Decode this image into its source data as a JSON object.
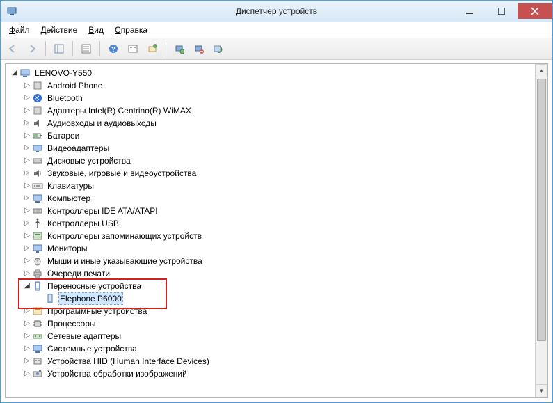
{
  "window": {
    "title": "Диспетчер устройств"
  },
  "menu": {
    "file": {
      "label": "Файл",
      "underline_index": 0
    },
    "action": {
      "label": "Действие",
      "underline_index": 0
    },
    "view": {
      "label": "Вид",
      "underline_index": 0
    },
    "help": {
      "label": "Справка",
      "underline_index": 0
    }
  },
  "toolbar": {
    "back": "back",
    "forward": "forward",
    "show_hide_tree": "show-hide-console-tree",
    "properties": "properties",
    "help": "help",
    "show_hidden": "show-hidden",
    "update_config": "update-driver-config",
    "scan": "scan-hardware",
    "remove": "remove-device",
    "update_drv": "update-driver"
  },
  "tree": {
    "root": {
      "label": "LENOVO-Y550",
      "icon": "computer"
    },
    "categories": [
      {
        "label": "Android Phone",
        "icon": "device-generic"
      },
      {
        "label": "Bluetooth",
        "icon": "bluetooth"
      },
      {
        "label": "Адаптеры Intel(R) Centrino(R) WiMAX",
        "icon": "device-generic"
      },
      {
        "label": "Аудиовходы и аудиовыходы",
        "icon": "audio"
      },
      {
        "label": "Батареи",
        "icon": "battery"
      },
      {
        "label": "Видеоадаптеры",
        "icon": "display-adapter"
      },
      {
        "label": "Дисковые устройства",
        "icon": "disk"
      },
      {
        "label": "Звуковые, игровые и видеоустройства",
        "icon": "sound"
      },
      {
        "label": "Клавиатуры",
        "icon": "keyboard"
      },
      {
        "label": "Компьютер",
        "icon": "computer"
      },
      {
        "label": "Контроллеры IDE ATA/ATAPI",
        "icon": "ide"
      },
      {
        "label": "Контроллеры USB",
        "icon": "usb"
      },
      {
        "label": "Контроллеры запоминающих устройств",
        "icon": "storage-controller"
      },
      {
        "label": "Мониторы",
        "icon": "monitor"
      },
      {
        "label": "Мыши и иные указывающие устройства",
        "icon": "mouse"
      },
      {
        "label": "Очереди печати",
        "icon": "printer"
      },
      {
        "label": "Переносные устройства",
        "icon": "portable",
        "expanded": true,
        "children": [
          {
            "label": "Elephone P6000",
            "icon": "portable-device",
            "selected": true
          }
        ]
      },
      {
        "label": "Программные устройства",
        "icon": "software-device"
      },
      {
        "label": "Процессоры",
        "icon": "cpu"
      },
      {
        "label": "Сетевые адаптеры",
        "icon": "network"
      },
      {
        "label": "Системные устройства",
        "icon": "system"
      },
      {
        "label": "Устройства HID (Human Interface Devices)",
        "icon": "hid"
      },
      {
        "label": "Устройства обработки изображений",
        "icon": "imaging"
      }
    ]
  }
}
